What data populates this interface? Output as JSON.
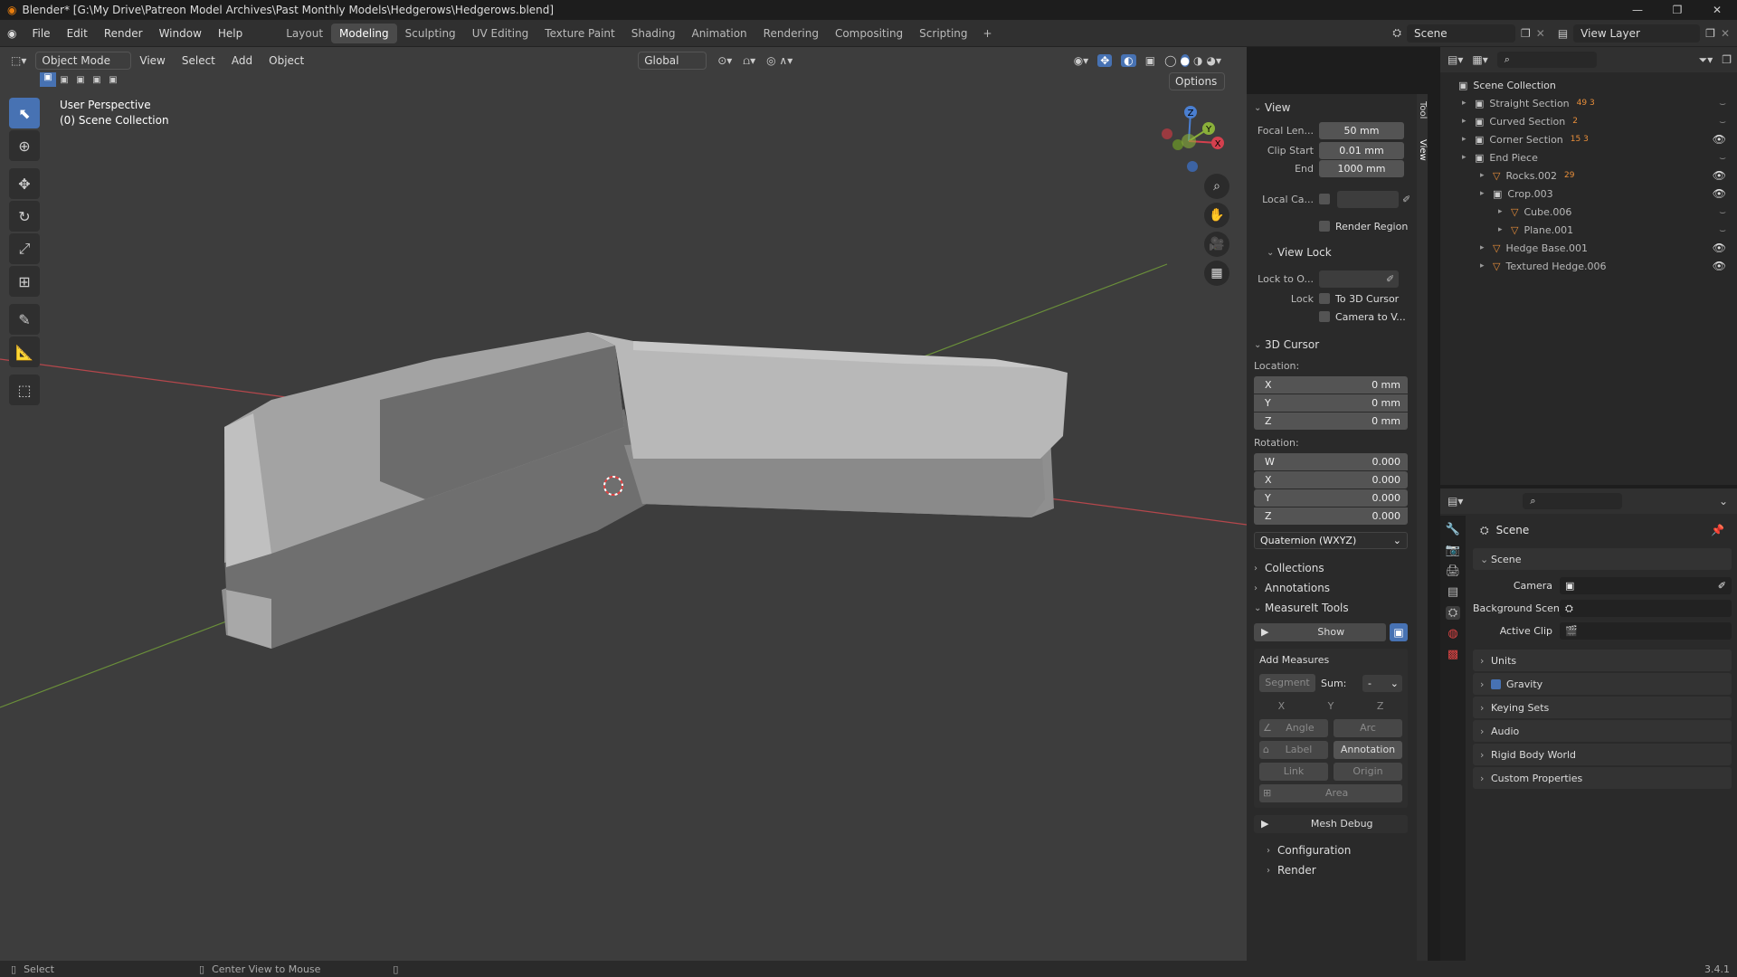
{
  "titlebar": {
    "title": "Blender* [G:\\My Drive\\Patreon Model Archives\\Past Monthly Models\\Hedgerows\\Hedgerows.blend]",
    "minimize": "—",
    "maximize": "❐",
    "close": "✕"
  },
  "menu": [
    "File",
    "Edit",
    "Render",
    "Window",
    "Help"
  ],
  "workspaces": [
    "Layout",
    "Modeling",
    "Sculpting",
    "UV Editing",
    "Texture Paint",
    "Shading",
    "Animation",
    "Rendering",
    "Compositing",
    "Scripting"
  ],
  "active_workspace": "Modeling",
  "scene_name": "Scene",
  "view_layer": "View Layer",
  "viewport": {
    "mode": "Object Mode",
    "menus": [
      "View",
      "Select",
      "Add",
      "Object"
    ],
    "orientation": "Global",
    "options": "Options",
    "overlay_line1": "User Perspective",
    "overlay_line2": "(0) Scene Collection",
    "gizmo": {
      "z": "Z",
      "y": "Y",
      "x": "X"
    }
  },
  "npanel": {
    "tabs": [
      "Tool",
      "View"
    ],
    "view_title": "View",
    "focal_label": "Focal Len...",
    "focal_value": "50 mm",
    "clip_start_label": "Clip Start",
    "clip_start_value": "0.01 mm",
    "clip_end_label": "End",
    "clip_end_value": "1000 mm",
    "local_camera_label": "Local Ca...",
    "render_region": "Render Region",
    "view_lock_title": "View Lock",
    "lock_to_label": "Lock to O...",
    "lock_label": "Lock",
    "to_3d_cursor": "To 3D Cursor",
    "camera_to_view": "Camera to V...",
    "cursor_title": "3D Cursor",
    "location_label": "Location:",
    "loc": [
      {
        "axis": "X",
        "value": "0 mm"
      },
      {
        "axis": "Y",
        "value": "0 mm"
      },
      {
        "axis": "Z",
        "value": "0 mm"
      }
    ],
    "rotation_label": "Rotation:",
    "rot": [
      {
        "axis": "W",
        "value": "0.000"
      },
      {
        "axis": "X",
        "value": "0.000"
      },
      {
        "axis": "Y",
        "value": "0.000"
      },
      {
        "axis": "Z",
        "value": "0.000"
      }
    ],
    "rotation_mode": "Quaternion (WXYZ)",
    "collections": "Collections",
    "annotations": "Annotations",
    "measureit_title": "MeasureIt Tools",
    "show": "Show",
    "add_measures": "Add Measures",
    "segment": "Segment",
    "sum_label": "Sum:",
    "sum_value": "-",
    "x": "X",
    "y": "Y",
    "z": "Z",
    "angle": "Angle",
    "arc": "Arc",
    "label": "Label",
    "annotation": "Annotation",
    "link": "Link",
    "origin": "Origin",
    "area": "Area",
    "mesh_debug": "Mesh Debug",
    "configuration": "Configuration",
    "render": "Render"
  },
  "outliner": {
    "root": "Scene Collection",
    "items": [
      {
        "name": "Straight Section",
        "depth": 0,
        "badge": "49 3",
        "visible": false
      },
      {
        "name": "Curved Section",
        "depth": 0,
        "badge": "2",
        "visible": false
      },
      {
        "name": "Corner Section",
        "depth": 0,
        "badge": "15 3",
        "visible": true
      },
      {
        "name": "End Piece",
        "depth": 0,
        "badge": "",
        "visible": false
      },
      {
        "name": "Rocks.002",
        "depth": 1,
        "badge": "29",
        "visible": true
      },
      {
        "name": "Crop.003",
        "depth": 1,
        "badge": "",
        "visible": true
      },
      {
        "name": "Cube.006",
        "depth": 2,
        "badge": "",
        "visible": false
      },
      {
        "name": "Plane.001",
        "depth": 2,
        "badge": "",
        "visible": false
      },
      {
        "name": "Hedge Base.001",
        "depth": 1,
        "badge": "",
        "visible": true
      },
      {
        "name": "Textured Hedge.006",
        "depth": 1,
        "badge": "",
        "visible": true
      }
    ]
  },
  "properties": {
    "header": "Scene",
    "scene_section": "Scene",
    "camera_label": "Camera",
    "background_scene_label": "Background Scene",
    "active_clip_label": "Active Clip",
    "sections": [
      "Units",
      "Gravity",
      "Keying Sets",
      "Audio",
      "Rigid Body World",
      "Custom Properties"
    ]
  },
  "status": {
    "select": "Select",
    "center_view": "Center View to Mouse",
    "version": "3.4.1"
  },
  "colors": {
    "accent": "#4772b3",
    "viewport_bg": "#3d3d3d",
    "x_axis": "#b5474c",
    "y_axis": "#6a8f3a"
  }
}
